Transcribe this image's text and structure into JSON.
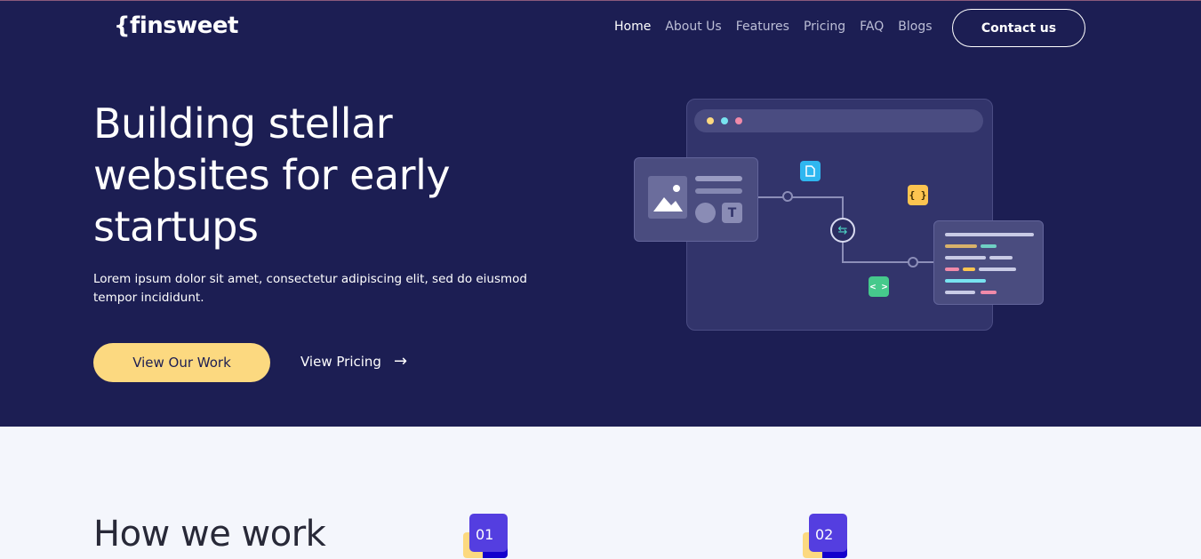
{
  "header": {
    "logo": "{finsweet",
    "nav": [
      "Home",
      "About Us",
      "Features",
      "Pricing",
      "FAQ",
      "Blogs"
    ],
    "active_nav": "Home",
    "contact_label": "Contact us"
  },
  "hero": {
    "title": "Building stellar websites for early startups",
    "subtitle": "Lorem ipsum dolor sit amet, consectetur adipiscing elit, sed do eiusmod tempor incididunt.",
    "primary_button": "View Our Work",
    "secondary_link": "View Pricing",
    "arrow": "→"
  },
  "illustration": {
    "window_dot_colors": [
      "#fcd980",
      "#78e3f0",
      "#f08aa9"
    ],
    "chips": {
      "doc_icon": "file-icon",
      "braces": "{ }",
      "code": "< >",
      "sync": "⇆",
      "text_tool": "T"
    },
    "chip_colors": {
      "doc": "#2fb7f0",
      "braces": "#fcc450",
      "code": "#46c98c"
    }
  },
  "how": {
    "title": "How we work",
    "steps": [
      "01",
      "02"
    ]
  },
  "colors": {
    "hero_bg": "#1c1e53",
    "accent": "#fcd980",
    "step": "#543ee0",
    "body_bg": "#f4f6fc"
  }
}
